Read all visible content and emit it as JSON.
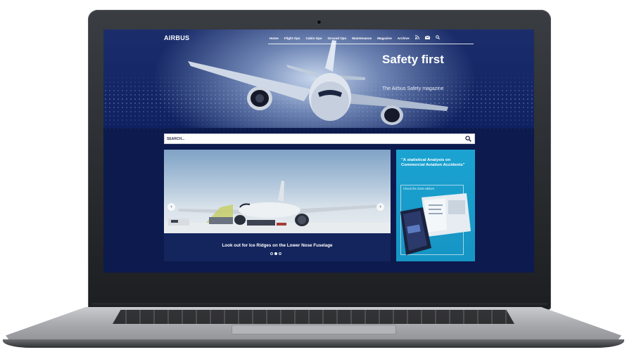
{
  "site": {
    "logo": "AIRBUS",
    "nav": {
      "items": [
        "Home",
        "Flight Ops",
        "Cabin Ops",
        "Ground Ops",
        "Maintenance",
        "Magazine",
        "Archive"
      ],
      "icons": [
        "rss-icon",
        "mail-icon",
        "search-icon"
      ]
    }
  },
  "hero": {
    "title": "Safety first",
    "subtitle": "The Airbus Safety magazine"
  },
  "search": {
    "placeholder": "SEARCH..."
  },
  "carousel": {
    "caption": "Look out for Ice Ridges on the Lower Nose Fuselage",
    "slide_count": 3,
    "active_slide": 2
  },
  "promo": {
    "title": "\"A statistical Analysis on Commercial Aviation Accidents\"",
    "link": "Check the 2016 edition!"
  },
  "colors": {
    "page_bg": "#0c1a4d",
    "promo_bg": "#1ba3d1",
    "text": "#ffffff"
  }
}
